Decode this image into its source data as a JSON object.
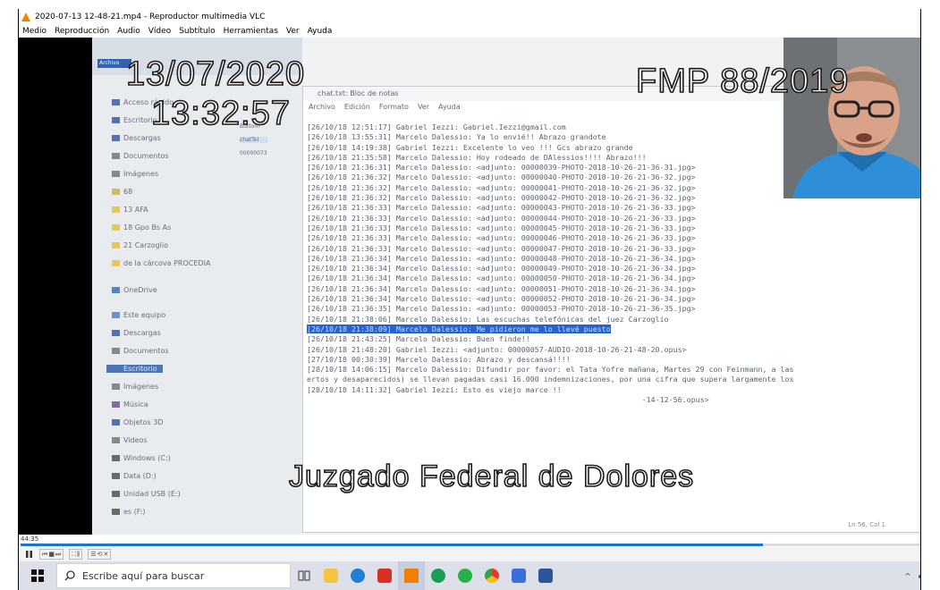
{
  "window": {
    "title": "2020-07-13 12-48-21.mp4 - Reproductor multimedia VLC"
  },
  "menu": [
    "Medio",
    "Reproducción",
    "Audio",
    "Vídeo",
    "Subtítulo",
    "Herramientas",
    "Ver",
    "Ayuda"
  ],
  "overlay": {
    "date": "13/07/2020",
    "time": "13:32:57",
    "case": "FMP 88/2019",
    "court": "Juzgado Federal de Dolores"
  },
  "explorer": {
    "tab": "Archivo",
    "nav_items": [
      "Acceso rápido",
      "Escritorio",
      "Descargas",
      "Documentos",
      "Imágenes",
      "68",
      "13 AFA",
      "18 Gpo Bs As",
      "21 Carzoglio",
      "de la cárcova PROCEDIA",
      "OneDrive",
      "Este equipo",
      "Descargas",
      "Documentos",
      "Escritorio",
      "Imágenes",
      "Música",
      "Objetos 3D",
      "Videos",
      "Windows (C:)",
      "Data (D:)",
      "Unidad USB (E:)",
      "es (F:)"
    ],
    "mid_items": [
      "Buttom",
      "chatTel",
      "00000073"
    ]
  },
  "notepad": {
    "title": "chat.txt: Bloc de notas",
    "menu": [
      "Archivo",
      "Edición",
      "Formato",
      "Ver",
      "Ayuda"
    ],
    "lines": [
      "[26/10/18 12:51:17] Gabriel Iezzi: Gabriel.Iezzi@gmail.com",
      "[26/10/18 13:55:31] Marcelo Dalessio: Ya lo envié!! Abrazo grandote",
      "[26/10/18 14:19:38] Gabriel Iezzi: Excelente lo veo !!! Gcs abrazo grande",
      "[26/10/18 21:35:58] Marcelo Dalessio: Hoy rodeado de DAlessios!!!! Abrazo!!!",
      "[26/10/18 21:36:31] Marcelo Dalessio: <adjunto: 00000039-PHOTO-2018-10-26-21-36-31.jpg>",
      "[26/10/18 21:36:32] Marcelo Dalessio: <adjunto: 00000040-PHOTO-2018-10-26-21-36-32.jpg>",
      "[26/10/18 21:36:32] Marcelo Dalessio: <adjunto: 00000041-PHOTO-2018-10-26-21-36-32.jpg>",
      "[26/10/18 21:36:32] Marcelo Dalessio: <adjunto: 00000042-PHOTO-2018-10-26-21-36-32.jpg>",
      "[26/10/18 21:36:33] Marcelo Dalessio: <adjunto: 00000043-PHOTO-2018-10-26-21-36-33.jpg>",
      "[26/10/18 21:36:33] Marcelo Dalessio: <adjunto: 00000044-PHOTO-2018-10-26-21-36-33.jpg>",
      "[26/10/18 21:36:33] Marcelo Dalessio: <adjunto: 00000045-PHOTO-2018-10-26-21-36-33.jpg>",
      "[26/10/18 21:36:33] Marcelo Dalessio: <adjunto: 00000046-PHOTO-2018-10-26-21-36-33.jpg>",
      "[26/10/18 21:36:33] Marcelo Dalessio: <adjunto: 00000047-PHOTO-2018-10-26-21-36-33.jpg>",
      "[26/10/18 21:36:34] Marcelo Dalessio: <adjunto: 00000048-PHOTO-2018-10-26-21-36-34.jpg>",
      "[26/10/18 21:36:34] Marcelo Dalessio: <adjunto: 00000049-PHOTO-2018-10-26-21-36-34.jpg>",
      "[26/10/18 21:36:34] Marcelo Dalessio: <adjunto: 00000050-PHOTO-2018-10-26-21-36-34.jpg>",
      "[26/10/18 21:36:34] Marcelo Dalessio: <adjunto: 00000051-PHOTO-2018-10-26-21-36-34.jpg>",
      "[26/10/18 21:36:34] Marcelo Dalessio: <adjunto: 00000052-PHOTO-2018-10-26-21-36-34.jpg>",
      "[26/10/18 21:36:35] Marcelo Dalessio: <adjunto: 00000053-PHOTO-2018-10-26-21-36-35.jpg>",
      "[26/10/18 21:38:06] Marcelo Dalessio: Las escuchas telefónicas del juez Carzoglio"
    ],
    "selected_line": "[26/10/18 21:38:09] Marcelo Dalessio: Me pidieron me lo llevé puesto",
    "lines_after": [
      "[26/10/18 21:43:25] Marcelo Dalessio: Buen finde!!",
      "[26/10/18 21:48:20] Gabriel Iezzi: <adjunto: 00000057-AUDIO-2018-10-26-21-48-20.opus>",
      "[27/10/18 00:30:39] Marcelo Dalessio: Abrazo y descansá!!!!",
      "[28/10/18 14:06:15] Marcelo Dalessio: Difundir por favor: el Tata Yofre mañana, Martes 29 con Feinmann, a las",
      "ertos y desaparecidos) se llevan pagadas casi 16.000 indemnizaciones, por una cifra que supera largamente los",
      "[28/10/18 14:11:32] Gabriel Iezzi: Esto es viejo marce !!",
      "                                                                           -14-12-56.opus>"
    ],
    "status": "Ln 56, Col 1"
  },
  "playback": {
    "time": "44:35",
    "progress": 0.825
  },
  "taskbar": {
    "search_placeholder": "Escribe aquí para buscar"
  },
  "colors": {
    "accent": "#1b76d2",
    "selection": "#2763d0",
    "vlc": "#f08000"
  }
}
